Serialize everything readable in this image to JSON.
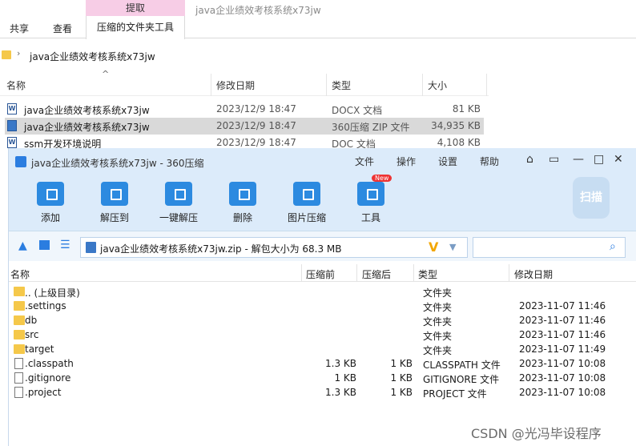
{
  "explorer": {
    "window_title": "java企业绩效考核系统x73jw",
    "ribbon": {
      "context_group": "提取",
      "tabs": [
        "共享",
        "查看",
        "压缩的文件夹工具"
      ]
    },
    "address": {
      "path": "java企业绩效考核系统x73jw"
    },
    "columns": [
      "名称",
      "修改日期",
      "类型",
      "大小"
    ],
    "files": [
      {
        "name": "java企业绩效考核系统x73jw",
        "date": "2023/12/9 18:47",
        "type": "DOCX 文档",
        "size": "81 KB",
        "icon": "word-doc-icon",
        "selected": false
      },
      {
        "name": "java企业绩效考核系统x73jw",
        "date": "2023/12/9 18:47",
        "type": "360压缩 ZIP 文件",
        "size": "34,935 KB",
        "icon": "zip-archive-icon",
        "selected": true
      },
      {
        "name": "ssm开发环境说明",
        "date": "2023/12/9 18:47",
        "type": "DOC 文档",
        "size": "4,108 KB",
        "icon": "word-doc-icon",
        "selected": false
      }
    ]
  },
  "zip360": {
    "title": "java企业绩效考核系统x73jw - 360压缩",
    "menu": [
      "文件",
      "操作",
      "设置",
      "帮助"
    ],
    "toolbar": [
      "添加",
      "解压到",
      "一键解压",
      "删除",
      "图片压缩",
      "工具"
    ],
    "new_badge": "New",
    "scan_label": "扫描",
    "path_label": "java企业绩效考核系统x73jw.zip - 解包大小为 68.3 MB",
    "path_v_mark": "V",
    "columns": [
      "名称",
      "压缩前",
      "压缩后",
      "类型",
      "修改日期"
    ],
    "entries": [
      {
        "name": ".. (上级目录)",
        "before": "",
        "after": "",
        "type": "文件夹",
        "date": "",
        "icon": "folder-icon"
      },
      {
        "name": ".settings",
        "before": "",
        "after": "",
        "type": "文件夹",
        "date": "2023-11-07 11:46",
        "icon": "folder-icon"
      },
      {
        "name": "db",
        "before": "",
        "after": "",
        "type": "文件夹",
        "date": "2023-11-07 11:46",
        "icon": "folder-icon"
      },
      {
        "name": "src",
        "before": "",
        "after": "",
        "type": "文件夹",
        "date": "2023-11-07 11:46",
        "icon": "folder-icon"
      },
      {
        "name": "target",
        "before": "",
        "after": "",
        "type": "文件夹",
        "date": "2023-11-07 11:49",
        "icon": "folder-icon"
      },
      {
        "name": ".classpath",
        "before": "1.3 KB",
        "after": "1 KB",
        "type": "CLASSPATH 文件",
        "date": "2023-11-07 10:08",
        "icon": "file-icon"
      },
      {
        "name": ".gitignore",
        "before": "1 KB",
        "after": "1 KB",
        "type": "GITIGNORE 文件",
        "date": "2023-11-07 10:08",
        "icon": "file-icon"
      },
      {
        "name": ".project",
        "before": "1.3 KB",
        "after": "1 KB",
        "type": "PROJECT 文件",
        "date": "2023-11-07 10:08",
        "icon": "file-icon"
      }
    ]
  },
  "watermark": "CSDN @光冯毕设程序"
}
